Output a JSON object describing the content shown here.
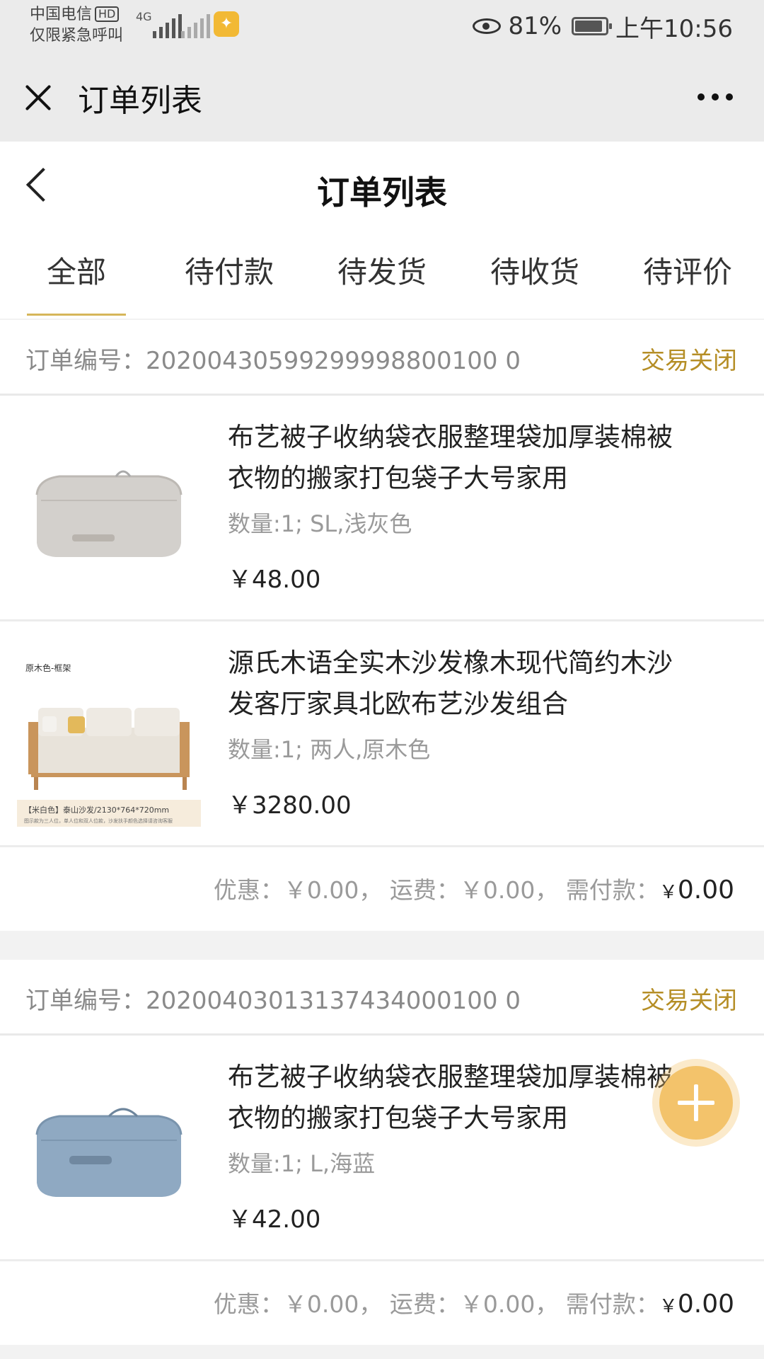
{
  "status_bar": {
    "carrier": "中国电信",
    "hd": "HD",
    "emergency": "仅限紧急呼叫",
    "network": "4G",
    "battery": "81%",
    "time": "上午10:56"
  },
  "wx_header": {
    "title": "订单列表"
  },
  "page": {
    "title": "订单列表"
  },
  "tabs": [
    {
      "label": "全部",
      "active": true
    },
    {
      "label": "待付款"
    },
    {
      "label": "待发货"
    },
    {
      "label": "待收货"
    },
    {
      "label": "待评价"
    }
  ],
  "orders": [
    {
      "order_no": "订单编号：20200430599299998800100 0",
      "status": "交易关闭",
      "items": [
        {
          "name": "布艺被子收纳袋衣服整理袋加厚装棉被衣物的搬家打包袋子大号家用",
          "spec": "数量:1; SL,浅灰色",
          "price": "￥48.00"
        },
        {
          "name": "源氏木语全实木沙发橡木现代简约木沙发客厅家具北欧布艺沙发组合",
          "spec": "数量:1; 两人,原木色",
          "price": "￥3280.00",
          "thumb_top_label": "原木色-框架",
          "thumb_caption": "【米白色】泰山沙发/2130*764*720mm",
          "thumb_note": "图示款为三人位，单人位和双人位款，沙发扶手颜色选择请咨询客服"
        }
      ],
      "summary": {
        "discount": "优惠：￥0.00，",
        "shipping": "运费：￥0.00，",
        "payable_label": "需付款：",
        "payable_cur": "￥",
        "payable": "0.00"
      }
    },
    {
      "order_no": "订单编号：20200403013137434000100 0",
      "status": "交易关闭",
      "items": [
        {
          "name": "布艺被子收纳袋衣服整理袋加厚装棉被衣物的搬家打包袋子大号家用",
          "spec": "数量:1; L,海蓝",
          "price": "￥42.00"
        }
      ],
      "summary": {
        "discount": "优惠：￥0.00，",
        "shipping": "运费：￥0.00，",
        "payable_label": "需付款：",
        "payable_cur": "￥",
        "payable": "0.00"
      }
    }
  ],
  "colors": {
    "accent": "#b58e26",
    "tab_underline": "#d6b65a",
    "fab": "#f3c36b"
  }
}
